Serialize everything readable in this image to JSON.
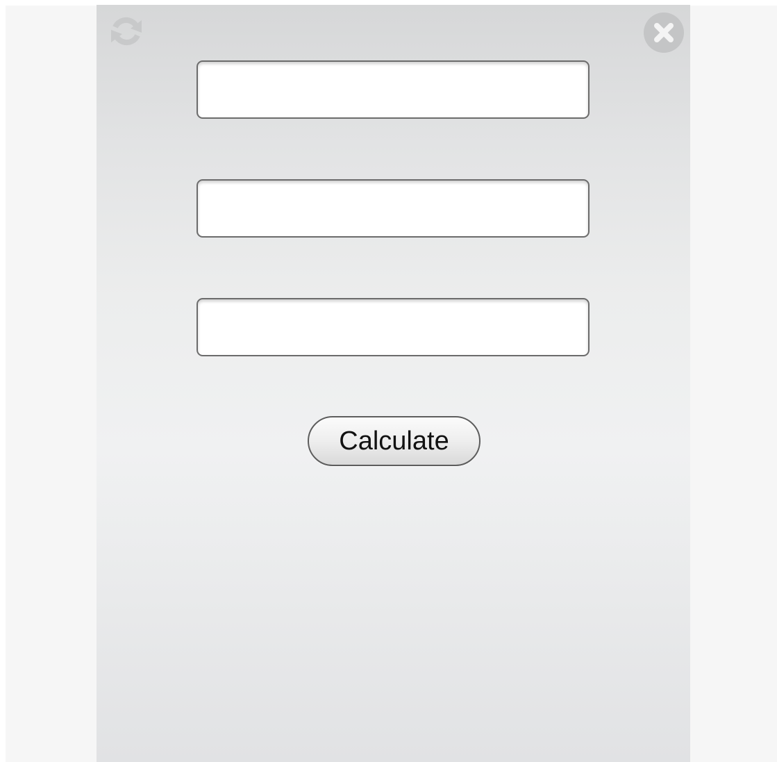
{
  "toolbar": {
    "refresh_icon": "refresh-icon",
    "close_icon": "close-icon"
  },
  "form": {
    "field_1": {
      "value": "",
      "placeholder": ""
    },
    "field_2": {
      "value": "",
      "placeholder": ""
    },
    "field_3": {
      "value": "",
      "placeholder": ""
    },
    "calculate_label": "Calculate"
  },
  "colors": {
    "icon": "#c4c5c6",
    "field_border": "#6b6b6b",
    "button_text": "#111111"
  }
}
